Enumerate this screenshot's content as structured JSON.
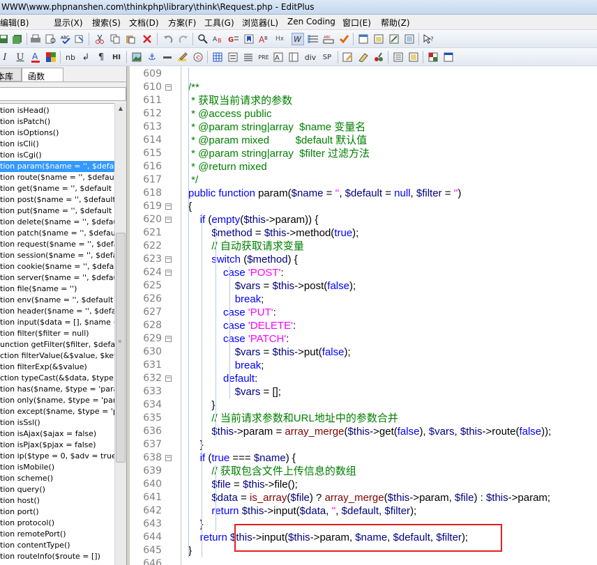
{
  "window": {
    "title": "WWW\\www.phpnanshen.com\\thinkphp\\library\\think\\Request.php - EditPlus"
  },
  "menu": [
    "编辑(B)",
    "显示(X)",
    "搜索(S)",
    "文档(D)",
    "方案(F)",
    "工具(G)",
    "浏览器(L)",
    "Zen Coding",
    "窗口(E)",
    "帮助(Z)"
  ],
  "toolbar2_labels": {
    "nb": "nb",
    "pre": "PRE",
    "div": "div",
    "sp": "SP",
    "hx": "Hx",
    "u": "U",
    "i": "I",
    "para": "¶",
    "hi": "HI"
  },
  "panel": {
    "tabs": [
      "文本库",
      "函数"
    ],
    "functions": [
      "tion isHead()",
      "tion isPatch()",
      "tion isOptions()",
      "tion isCli()",
      "tion isCgi()",
      "tion param($name = '', $default",
      "tion route($name = '', $default =",
      "tion get($name = '', $default =",
      "tion post($name = '', $default =",
      "tion put($name = '', $default =",
      "tion delete($name = '', $default",
      "tion patch($name = '', $default",
      "tion request($name = '', $defau",
      "tion session($name = '', $defau",
      "tion cookie($name = '', $defaul",
      "tion server($name = '', $default",
      "tion file($name = '')",
      "tion env($name = '', $default =",
      "tion header($name = '', $defau",
      "tion input($data = [], $name =",
      "tion filter($filter = null)",
      "unction getFilter($filter, $defau",
      "ction filterValue(&$value, $key,",
      "tion filterExp(&$value)",
      "ction typeCast(&$data, $type)",
      "tion has($name, $type = 'paran",
      "tion only($name, $type = 'para",
      "tion except($name, $type = 'pa",
      "tion isSsl()",
      "tion isAjax($ajax = false)",
      "tion isPjax($pjax = false)",
      "tion ip($type = 0, $adv = true)",
      "tion isMobile()",
      "tion scheme()",
      "tion query()",
      "tion host()",
      "tion port()",
      "tion protocol()",
      "tion remotePort()",
      "tion contentType()",
      "tion routeInfo($route = [])"
    ],
    "selected_index": 5
  },
  "editor": {
    "lines": [
      {
        "n": "609",
        "fold": false,
        "text": ""
      },
      {
        "n": "610",
        "fold": true,
        "text": "/**"
      },
      {
        "n": "611",
        "fold": false,
        "text": " * 获取当前请求的参数"
      },
      {
        "n": "612",
        "fold": false,
        "text": " * @access public"
      },
      {
        "n": "613",
        "fold": false,
        "text": " * @param string|array  $name 变量名"
      },
      {
        "n": "614",
        "fold": false,
        "text": " * @param mixed         $default 默认值"
      },
      {
        "n": "615",
        "fold": false,
        "text": " * @param string|array  $filter 过滤方法"
      },
      {
        "n": "616",
        "fold": false,
        "text": " * @return mixed"
      },
      {
        "n": "617",
        "fold": false,
        "text": " */"
      },
      {
        "n": "618",
        "fold": false,
        "text": "public function param($name = '', $default = null, $filter = '')"
      },
      {
        "n": "619",
        "fold": true,
        "text": "{"
      },
      {
        "n": "620",
        "fold": true,
        "text": "    if (empty($this->param)) {"
      },
      {
        "n": "621",
        "fold": false,
        "text": "        $method = $this->method(true);"
      },
      {
        "n": "622",
        "fold": false,
        "text": "        // 自动获取请求变量"
      },
      {
        "n": "623",
        "fold": true,
        "text": "        switch ($method) {"
      },
      {
        "n": "624",
        "fold": true,
        "text": "            case 'POST':"
      },
      {
        "n": "625",
        "fold": false,
        "text": "                $vars = $this->post(false);"
      },
      {
        "n": "626",
        "fold": false,
        "text": "                break;"
      },
      {
        "n": "627",
        "fold": false,
        "text": "            case 'PUT':"
      },
      {
        "n": "628",
        "fold": false,
        "text": "            case 'DELETE':"
      },
      {
        "n": "629",
        "fold": true,
        "text": "            case 'PATCH':"
      },
      {
        "n": "630",
        "fold": false,
        "text": "                $vars = $this->put(false);"
      },
      {
        "n": "631",
        "fold": false,
        "text": "                break;"
      },
      {
        "n": "632",
        "fold": true,
        "text": "            default:"
      },
      {
        "n": "633",
        "fold": false,
        "text": "                $vars = [];"
      },
      {
        "n": "634",
        "fold": false,
        "text": "        }"
      },
      {
        "n": "635",
        "fold": false,
        "text": "        // 当前请求参数和URL地址中的参数合并"
      },
      {
        "n": "636",
        "fold": false,
        "text": "        $this->param = array_merge($this->get(false), $vars, $this->route(false));"
      },
      {
        "n": "637",
        "fold": false,
        "text": "    }"
      },
      {
        "n": "638",
        "fold": true,
        "text": "    if (true === $name) {"
      },
      {
        "n": "639",
        "fold": false,
        "text": "        // 获取包含文件上传信息的数组"
      },
      {
        "n": "640",
        "fold": false,
        "text": "        $file = $this->file();"
      },
      {
        "n": "641",
        "fold": false,
        "text": "        $data = is_array($file) ? array_merge($this->param, $file) : $this->param;"
      },
      {
        "n": "642",
        "fold": false,
        "text": "        return $this->input($data, '', $default, $filter);"
      },
      {
        "n": "643",
        "fold": false,
        "text": "    }"
      },
      {
        "n": "644",
        "fold": false,
        "text": "    return $this->input($this->param, $name, $default, $filter);"
      },
      {
        "n": "645",
        "fold": false,
        "text": "}"
      },
      {
        "n": "646",
        "fold": false,
        "text": ""
      }
    ]
  },
  "colors": {
    "keyword": "#0000ff",
    "string": "#ff00ff",
    "comment": "#008000",
    "variable": "#000080",
    "function": "#800000",
    "highlight": "#e02020",
    "selection": "#3399ff"
  }
}
